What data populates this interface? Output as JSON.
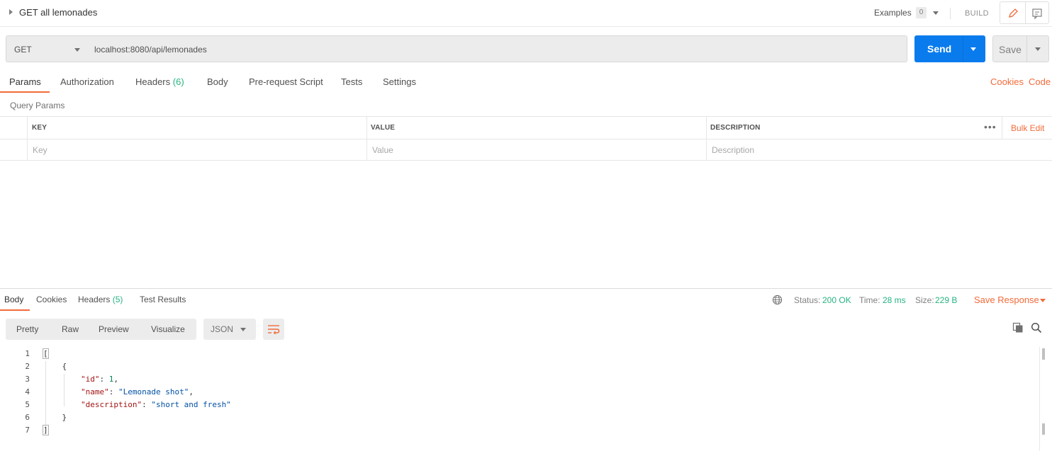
{
  "title_bar": {
    "request_name": "GET all lemonades",
    "examples_label": "Examples",
    "examples_count": "0",
    "build_label": "BUILD"
  },
  "request": {
    "method": "GET",
    "url": "localhost:8080/api/lemonades",
    "send_label": "Send",
    "save_label": "Save"
  },
  "request_tabs": {
    "params": "Params",
    "authorization": "Authorization",
    "headers": "Headers",
    "headers_count": "(6)",
    "body": "Body",
    "pre_request": "Pre-request Script",
    "tests": "Tests",
    "settings": "Settings",
    "cookies": "Cookies",
    "code": "Code"
  },
  "query_params": {
    "title": "Query Params",
    "columns": [
      "KEY",
      "VALUE",
      "DESCRIPTION"
    ],
    "placeholders": [
      "Key",
      "Value",
      "Description"
    ],
    "bulk_edit": "Bulk Edit"
  },
  "response_tabs": {
    "body": "Body",
    "cookies": "Cookies",
    "headers": "Headers",
    "headers_count": "(5)",
    "test_results": "Test Results"
  },
  "response_status": {
    "status_label": "Status:",
    "status_value": "200 OK",
    "time_label": "Time:",
    "time_value": "28 ms",
    "size_label": "Size:",
    "size_value": "229 B",
    "save_response": "Save Response"
  },
  "view_modes": {
    "pretty": "Pretty",
    "raw": "Raw",
    "preview": "Preview",
    "visualize": "Visualize",
    "format": "JSON"
  },
  "response_body": {
    "line_numbers": [
      "1",
      "2",
      "3",
      "4",
      "5",
      "6",
      "7"
    ],
    "l1": "[",
    "l2": "{",
    "l3_key": "\"id\"",
    "l3_sep": ": ",
    "l3_val": "1",
    "l3_end": ",",
    "l4_key": "\"name\"",
    "l4_sep": ": ",
    "l4_val": "\"Lemonade shot\"",
    "l4_end": ",",
    "l5_key": "\"description\"",
    "l5_sep": ": ",
    "l5_val": "\"short and fresh\"",
    "l6": "}",
    "l7": "]"
  },
  "colors": {
    "accent": "#f26b3a",
    "send_button": "#097bed",
    "success": "#26b47f"
  }
}
